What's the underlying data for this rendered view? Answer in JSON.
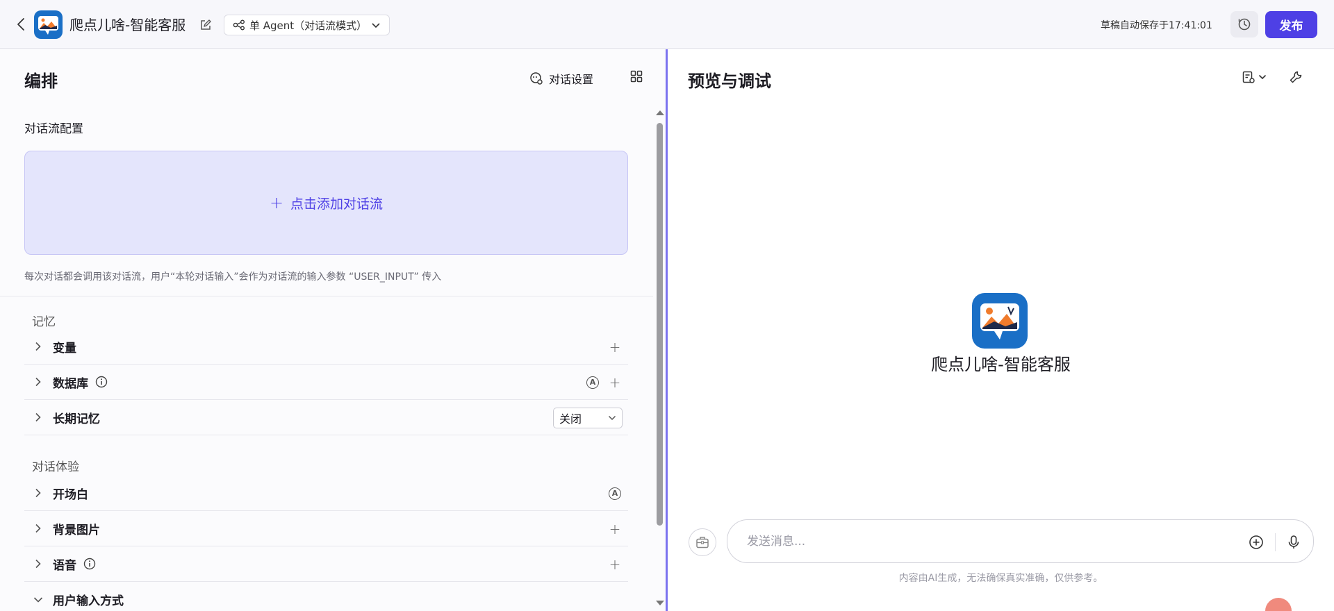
{
  "header": {
    "app_title": "爬点儿啥-智能客服",
    "mode_label": "单 Agent（对话流模式）",
    "save_status": "草稿自动保存于17:41:01",
    "publish_label": "发布"
  },
  "left": {
    "title": "编排",
    "chat_settings_label": "对话设置",
    "flow_section_title": "对话流配置",
    "add_flow_label": "点击添加对话流",
    "flow_hint": "每次对话都会调用该对话流，用户“本轮对话输入”会作为对话流的输入参数 “USER_INPUT” 传入",
    "memory_group": "记忆",
    "memory_items": {
      "variables": "变量",
      "database": "数据库",
      "long_memory": "长期记忆",
      "long_memory_value": "关闭"
    },
    "experience_group": "对话体验",
    "experience_items": {
      "opening": "开场白",
      "background": "背景图片",
      "voice": "语音",
      "input_method": "用户输入方式"
    },
    "auto_badge_letter": "A"
  },
  "right": {
    "title": "预览与调试",
    "bot_name": "爬点儿啥-智能客服",
    "message_placeholder": "发送消息...",
    "disclaimer": "内容由AI生成，无法确保真实准确，仅供参考。"
  },
  "colors": {
    "accent": "#4e40e5",
    "splitter": "#7b73ef",
    "add_flow_bg": "#e4e5fc",
    "logo_bg": "#1a6fc6"
  }
}
